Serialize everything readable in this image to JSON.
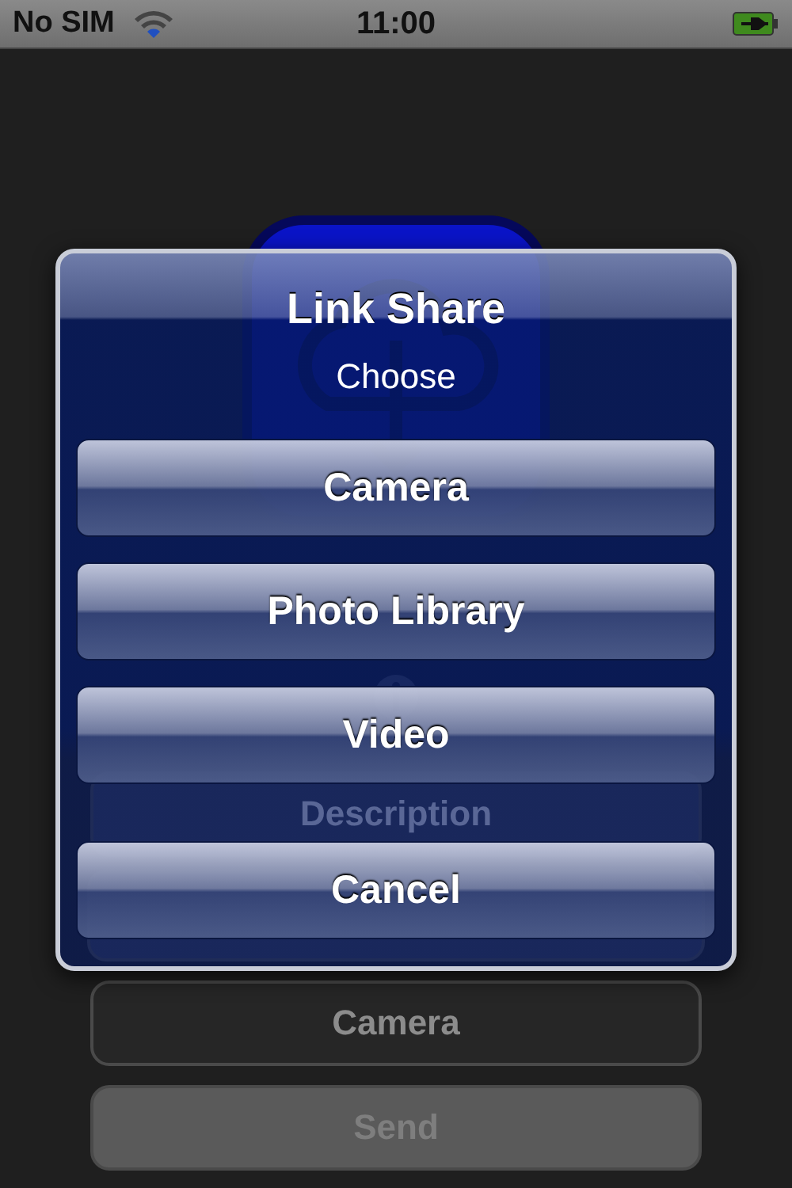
{
  "status_bar": {
    "carrier": "No SIM",
    "time": "11:00",
    "charging": true
  },
  "screen": {
    "buttons": [
      {
        "label": "Description",
        "kind": "behind"
      },
      {
        "kind": "behind"
      },
      {
        "label": "Camera",
        "kind": "plain",
        "disabled": false
      },
      {
        "label": "Send",
        "kind": "plain",
        "disabled": true
      }
    ]
  },
  "alert": {
    "title": "Link Share",
    "message": "Choose",
    "buttons": [
      {
        "label": "Camera"
      },
      {
        "label": "Photo Library"
      },
      {
        "label": "Video"
      },
      {
        "label": "Cancel",
        "kind": "cancel"
      }
    ]
  }
}
